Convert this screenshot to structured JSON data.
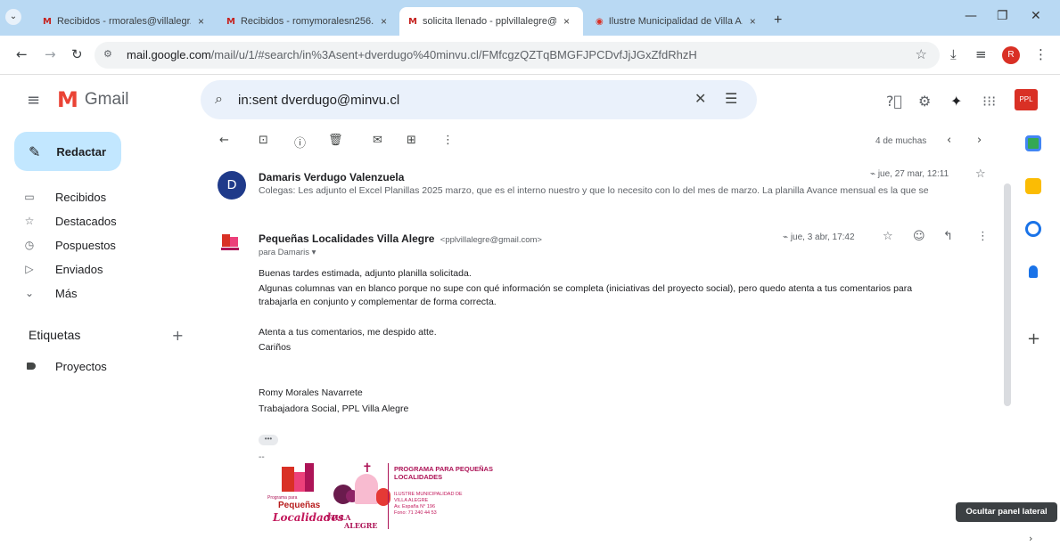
{
  "browser": {
    "tabs": [
      {
        "favicon": "gmail-icon",
        "title": "Recibidos - rmorales@villalegr...",
        "active": false
      },
      {
        "favicon": "gmail-icon",
        "title": "Recibidos - romymoralesn256...",
        "active": false
      },
      {
        "favicon": "gmail-icon",
        "title": "solicita llenado - pplvillalegre@...",
        "active": true
      },
      {
        "favicon": "municipality-icon",
        "title": "Ilustre Municipalidad de Villa A...",
        "active": false
      }
    ],
    "tab_close": "×",
    "new_tab": "+",
    "url_host": "mail.google.com",
    "url_path": "/mail/u/1/#search/in%3Asent+dverdugo%40minvu.cl/FMfcgzQZTqBMGFJPCDvfJjJGxZfdRhzH",
    "profile_initial": "R"
  },
  "gmail": {
    "logo_text": "Gmail",
    "search_query": "in:sent dverdugo@minvu.cl",
    "compose_label": "Redactar",
    "nav": [
      {
        "icon": "inbox-icon",
        "label": "Recibidos"
      },
      {
        "icon": "star-icon",
        "label": "Destacados"
      },
      {
        "icon": "clock-icon",
        "label": "Pospuestos"
      },
      {
        "icon": "send-icon",
        "label": "Enviados"
      },
      {
        "icon": "chevron-down-icon",
        "label": "Más"
      }
    ],
    "labels_heading": "Etiquetas",
    "labels": [
      {
        "label": "Proyectos"
      }
    ],
    "pager": "4 de muchas"
  },
  "thread": {
    "messages": [
      {
        "avatar_initial": "D",
        "sender": "Damaris Verdugo Valenzuela",
        "snippet": "Colegas: Les adjunto el Excel Planillas 2025 marzo, que es el interno nuestro y que lo necesito con lo del mes de marzo. La planilla Avance mensual es la que se",
        "date": "jue, 27 mar, 12:11"
      },
      {
        "sender": "Pequeñas Localidades Villa Alegre",
        "email": "<pplvillalegre@gmail.com>",
        "to": "para Damaris ▾",
        "date": "jue, 3 abr, 17:42",
        "body": [
          "Buenas tardes estimada, adjunto planilla solicitada.",
          "Algunas columnas van en blanco porque no supe con qué información se completa (iniciativas del proyecto social), pero quedo atenta a tus comentarios para",
          "trabajarla en conjunto y complementar de forma correcta.",
          "Atenta a tus comentarios, me despido atte.",
          "Cariños",
          "Romy Morales Navarrete",
          "Trabajadora Social, PPL Villa Alegre"
        ],
        "ellipsis": "•••",
        "signature_dash": "--"
      }
    ]
  },
  "signature": {
    "small_text": "Programa para",
    "pequenas": "Pequeñas",
    "localidades": "Localidades",
    "villa": "VILLA",
    "alegre": "ALEGRE",
    "program_line1": "PROGRAMA PARA PEQUEÑAS",
    "program_line2": "LOCALIDADES",
    "muni_line1": "ILUSTRE MUNICIPALIDAD DE",
    "muni_line2": "VILLA ALEGRE",
    "muni_line3": "Av. España N° 196",
    "muni_line4": "Fono: 71 240 44 53"
  },
  "tooltip": "Ocultar panel lateral",
  "colors": {
    "tabstrip": "#b9d9f3",
    "compose": "#c2e7ff",
    "search": "#eaf1fb",
    "brand_red": "#ea4335"
  }
}
